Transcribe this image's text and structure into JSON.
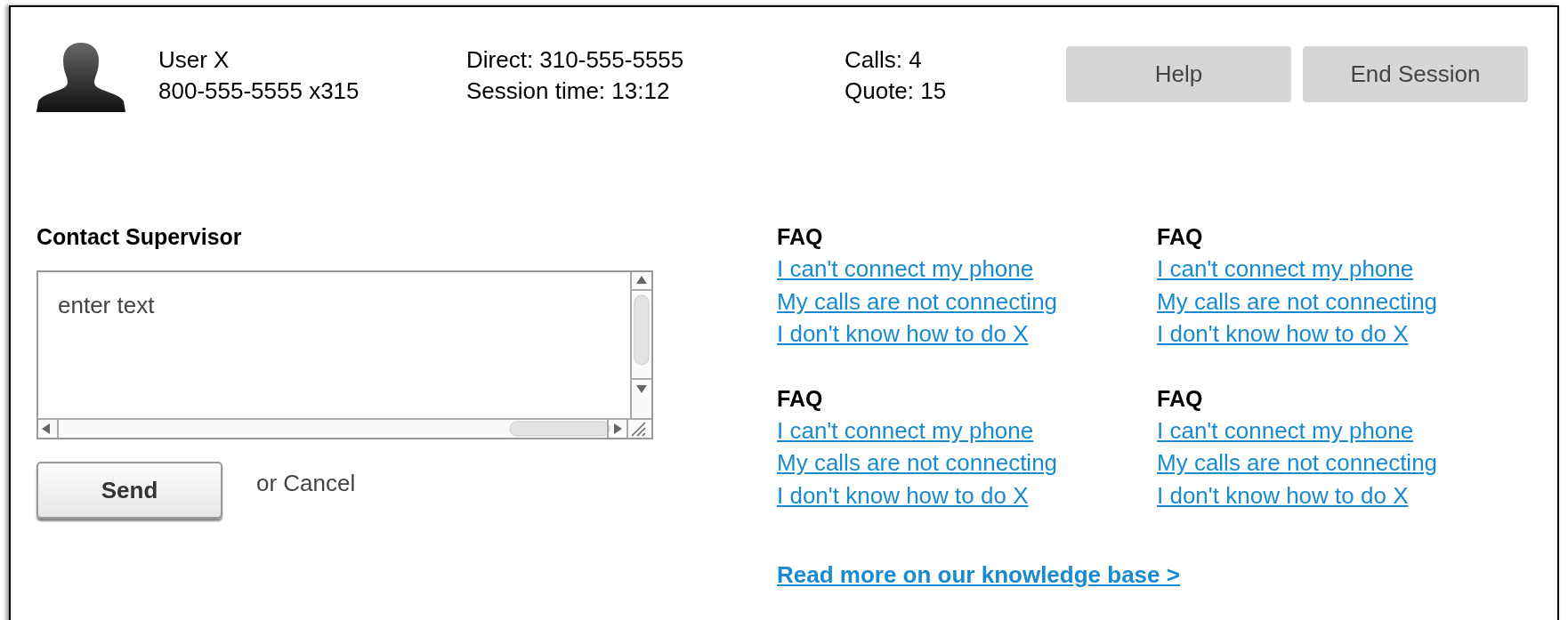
{
  "user": {
    "name": "User X",
    "phone": "800-555-5555 x315"
  },
  "session": {
    "direct": "Direct: 310-555-5555",
    "time": "Session time: 13:12"
  },
  "stats": {
    "calls": "Calls: 4",
    "quote": "Quote: 15"
  },
  "header_buttons": [
    "Help",
    "End Session"
  ],
  "contact": {
    "title": "Contact Supervisor",
    "message": {
      "placeholder": "enter text"
    },
    "send": "Send",
    "cancel": "or Cancel"
  },
  "faq_groups": [
    {
      "title": "FAQ",
      "links": [
        "I can't connect my phone",
        "My calls are not connecting",
        "I don't know how to do X"
      ]
    },
    {
      "title": "FAQ",
      "links": [
        "I can't connect my phone",
        "My calls are not connecting",
        "I don't know how to do X"
      ]
    },
    {
      "title": "FAQ",
      "links": [
        "I can't connect my phone",
        "My calls are not connecting",
        "I don't know how to do X"
      ]
    },
    {
      "title": "FAQ",
      "links": [
        "I can't connect my phone",
        "My calls are not connecting",
        "I don't know how to do X"
      ]
    }
  ],
  "knowledge_base_link": "Read more on our knowledge base >"
}
